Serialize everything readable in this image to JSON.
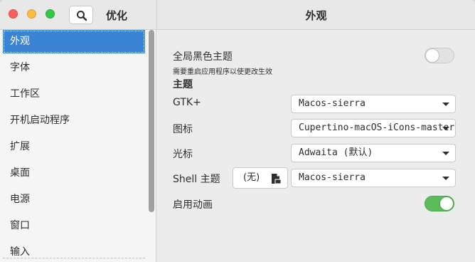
{
  "app": {
    "title": "优化",
    "page_title": "外观"
  },
  "sidebar": {
    "items": [
      {
        "label": "外观",
        "active": true
      },
      {
        "label": "字体"
      },
      {
        "label": "工作区"
      },
      {
        "label": "开机启动程序"
      },
      {
        "label": "扩展"
      },
      {
        "label": "桌面"
      },
      {
        "label": "电源"
      },
      {
        "label": "窗口"
      },
      {
        "label": "输入"
      }
    ]
  },
  "main": {
    "dark_theme": {
      "label": "全局黑色主题",
      "note": "需要重启应用程序以使更改生效",
      "enabled": false
    },
    "themes_heading": "主题",
    "gtk": {
      "label": "GTK+",
      "value": "Macos-sierra"
    },
    "icons": {
      "label": "图标",
      "value": "Cupertino-macOS-iCons-master"
    },
    "cursor": {
      "label": "光标",
      "value": "Adwaita (默认)"
    },
    "shell": {
      "label": "Shell 主题",
      "file_label": "(无)",
      "value": "Macos-sierra"
    },
    "animations": {
      "label": "启用动画",
      "enabled": true
    }
  },
  "colors": {
    "accent": "#3b84d4",
    "switch_on": "#5cbc5c"
  },
  "icons": {
    "search": "search-icon",
    "document": "document-icon",
    "dropdown": "chevron-down-icon"
  }
}
